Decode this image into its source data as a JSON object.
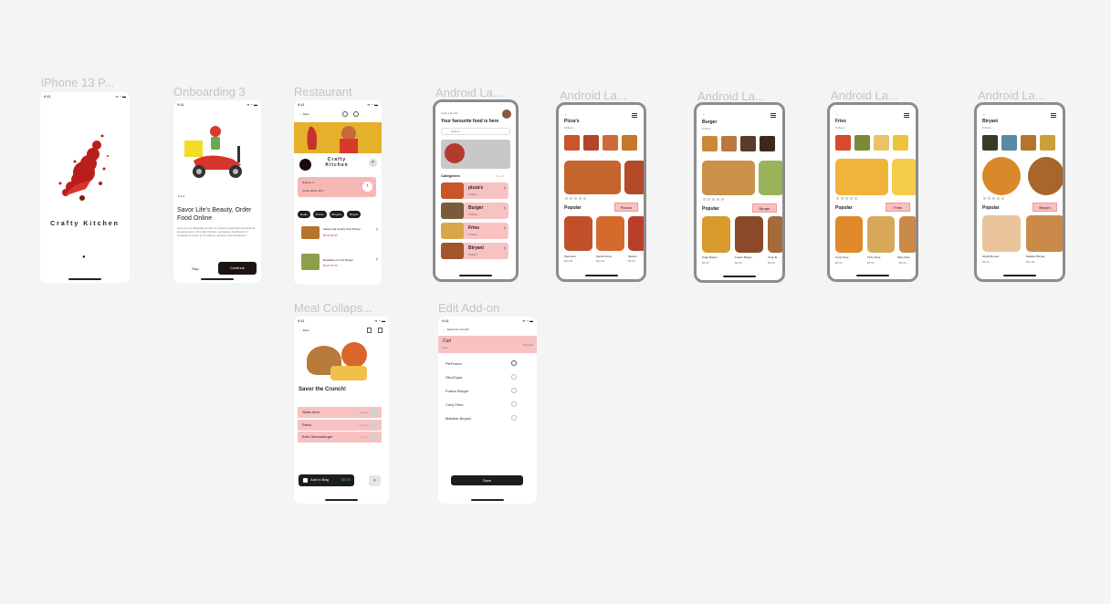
{
  "frames": {
    "iphone_title": "iPhone 13 P...",
    "onboarding_title": "Onboarding 3",
    "restaurant_title": "Restaurant",
    "android1_title": "Android La...",
    "android2_title": "Android La...",
    "android3_title": "Android La...",
    "android4_title": "Android La...",
    "android5_title": "Android La...",
    "meal_title": "Meal Collaps...",
    "addon_title": "Edit Add-on"
  },
  "status": {
    "time": "9:41",
    "icons": "▪▪ ◔ ▬"
  },
  "splash": {
    "brand": "Crafty Kitchen",
    "dot": "●"
  },
  "onboarding": {
    "heading": "Savor Life's Beauty, Order Food Online",
    "body": "Join us on a delightful journey of culinary exploration and friends. At gastronomy. At Crafty Kitchen, we believe that flavors of creativity is meant to be shared, savored, and celebrated.",
    "skip": "Skip",
    "continue": "Continue",
    "page_dots": "● ● ●"
  },
  "restaurant": {
    "back": "← Back",
    "brand": "Crafty Kitchen",
    "rating": "Ratings 4",
    "location": "Outlet 28 km 2Km",
    "chips": [
      "Deals",
      "Pizzas",
      "Burgers",
      "Biryani"
    ],
    "items": [
      {
        "name": "Sweet and Smoky Pork Burger",
        "price": "$8.00  $6.50"
      },
      {
        "name": "Breakfast Crunch Burger",
        "price": "$9.00  $7.50"
      }
    ]
  },
  "home": {
    "greeting": "Hello Canadis",
    "headline": "Your favourite food is here",
    "search_placeholder": "Search",
    "categories_label": "Categories",
    "see_all": "See All",
    "categories": [
      {
        "name": "pizza's",
        "count": "9 Menu"
      },
      {
        "name": "Burger",
        "count": "5 Menu"
      },
      {
        "name": "Fries",
        "count": "5 Menu"
      },
      {
        "name": "Biryani",
        "count": "5 Menu"
      }
    ]
  },
  "pizza": {
    "title": "Pizza's",
    "count": "9 Menu",
    "popular": "Popular",
    "tag": "Pizza's",
    "items": [
      {
        "name": "PieFusion",
        "price": "$10.00"
      },
      {
        "name": "Zenith Pizza",
        "price": "$12.00"
      },
      {
        "name": "SliceCr...",
        "price": "$9.50"
      }
    ]
  },
  "burger": {
    "title": "Burger",
    "count": "5 Menu",
    "popular": "Popular",
    "tag": "Burger",
    "items": [
      {
        "name": "Snap Burger",
        "price": "$8.00"
      },
      {
        "name": "Fusion Burger",
        "price": "$9.50"
      },
      {
        "name": "Crisp B...",
        "price": "$9.00"
      }
    ]
  },
  "fries": {
    "title": "Fries",
    "count": "5 Menu",
    "popular": "Popular",
    "tag": "Fries",
    "items": [
      {
        "name": "Curly Fries",
        "price": "$5.00"
      },
      {
        "name": "Tizzy Fries",
        "price": "$4.50"
      },
      {
        "name": "Miso Fries",
        "price": "$5.50"
      }
    ]
  },
  "biryani": {
    "title": "Biryani",
    "count": "5 Menu",
    "popular": "Popular",
    "tag": "Biryani",
    "items": [
      {
        "name": "Sindhi Biryani",
        "price": "$9.00"
      },
      {
        "name": "Malabar Biryani",
        "price": "$10.00"
      }
    ]
  },
  "meal": {
    "back": "← Back",
    "title": "Savor the Crunch!",
    "rows": [
      {
        "name": "Sides Item",
        "tag": "Regular"
      },
      {
        "name": "Pizza",
        "tag": "Regular"
      },
      {
        "name": "Edit Cheeseburger",
        "tag": "Medium"
      }
    ],
    "add_to_bag": "Add to Bag",
    "price": "$5.00"
  },
  "addon": {
    "back": "←  Savor the Crunch!",
    "header_title": "Curl",
    "header_sub": "Edit",
    "header_right": "Regular",
    "options": [
      "PieFusion",
      "SliceTopia",
      "Fusion Burger",
      "Curly Fries",
      "Malabar Biryani"
    ],
    "save": "Save"
  },
  "colors": {
    "accent": "#f8c2c2",
    "brand_red": "#c8322c",
    "dark": "#1d1d1d"
  }
}
